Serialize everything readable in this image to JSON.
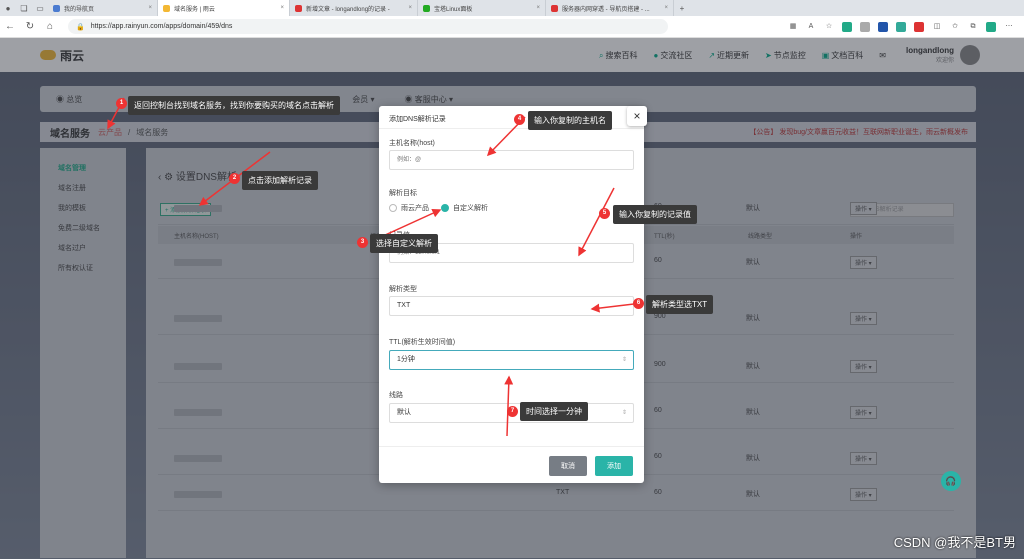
{
  "browser": {
    "tabs": [
      {
        "label": "我的导航页",
        "active": false,
        "color": "#4a7bd0"
      },
      {
        "label": "域名服务 | 雨云",
        "active": true,
        "color": "#f3b834"
      },
      {
        "label": "新增文章 - longandlong的记录 -",
        "active": false,
        "color": "#d33"
      },
      {
        "label": "宝塔Linux面板",
        "active": false,
        "color": "#2a2"
      },
      {
        "label": "服务器内网穿透 - 导航页搭建 - ...",
        "active": false,
        "color": "#d33"
      }
    ],
    "url": "https://app.rainyun.com/apps/domain/459/dns"
  },
  "site": {
    "logo": "雨云",
    "nav": [
      "搜索百科",
      "交流社区",
      "近期更新",
      "节点监控",
      "文档百科"
    ],
    "user_name": "longandlong",
    "user_sub": "欢迎你",
    "menu": [
      "总览",
      "",
      "",
      "会员",
      "客服中心"
    ],
    "page_title": "域名服务",
    "crumb_parent": "云产品",
    "crumb_current": "域名服务",
    "notice": "【公告】 发现bug/文章赢百元收益！互联网新职业诞生，雨云新概发布",
    "sidebar": [
      "域名管理",
      "域名注册",
      "我的模板",
      "免费二级域名",
      "域名过户",
      "所有权认证"
    ],
    "main_title": "设置DNS解析",
    "add_btn": "+ 添加解析记录",
    "search_placeholder": "搜索DNS解析记录",
    "table_headers": [
      "主机名称(HOST)",
      "记录值",
      "TTL(秒)",
      "线路类型",
      "操作"
    ],
    "rows": [
      {
        "ttl": "60",
        "line": "默认",
        "op": "操作 ▾"
      },
      {
        "ttl": "60",
        "line": "默认",
        "op": "操作 ▾"
      },
      {
        "ttl": "900",
        "line": "默认",
        "op": "操作 ▾"
      },
      {
        "ttl": "900",
        "line": "默认",
        "op": "操作 ▾"
      },
      {
        "ttl": "60",
        "line": "默认",
        "op": "操作 ▾"
      },
      {
        "ttl": "60",
        "line": "默认",
        "op": "操作 ▾"
      },
      {
        "type": "TXT",
        "ttl": "60",
        "line": "默认",
        "op": "操作 ▾"
      }
    ]
  },
  "modal": {
    "title": "添加DNS解析记录",
    "host_label": "主机名称(host)",
    "host_placeholder": "例如：@",
    "target_label": "解析目标",
    "radio_1": "雨云产品",
    "radio_2": "自定义解析",
    "value_label": "记录值",
    "value_placeholder": "例如：127.0.0.1",
    "type_label": "解析类型",
    "type_value": "TXT",
    "ttl_label": "TTL(解析生效时间值)",
    "ttl_value": "1分钟",
    "line_label": "线路",
    "line_value": "默认",
    "cancel": "取消",
    "submit": "添加"
  },
  "annotations": [
    {
      "n": "1",
      "text": "返回控制台找到域名服务，找到你要购买的域名点击解析"
    },
    {
      "n": "2",
      "text": "点击添加解析记录"
    },
    {
      "n": "3",
      "text": "选择自定义解析"
    },
    {
      "n": "4",
      "text": "输入你复制的主机名"
    },
    {
      "n": "5",
      "text": "输入你复制的记录值"
    },
    {
      "n": "6",
      "text": "解析类型选TXT"
    },
    {
      "n": "7",
      "text": "时间选择一分钟"
    }
  ],
  "watermark": "CSDN @我不是BT男",
  "colors": {
    "accent": "#2ab4a8",
    "annotation": "#e33"
  }
}
